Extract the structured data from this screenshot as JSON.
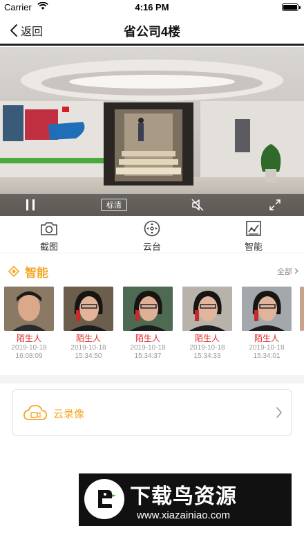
{
  "status_bar": {
    "carrier": "Carrier",
    "time": "4:16 PM"
  },
  "nav": {
    "back_label": "返回",
    "title": "省公司4楼"
  },
  "player": {
    "quality_label": "标清"
  },
  "toolbar": [
    {
      "label": "截图",
      "icon": "camera-icon"
    },
    {
      "label": "云台",
      "icon": "ptz-icon"
    },
    {
      "label": "智能",
      "icon": "smart-chart-icon"
    }
  ],
  "smart": {
    "title": "智能",
    "all_label": "全部",
    "faces": [
      {
        "name": "陌生人",
        "date": "2019-10-18",
        "time": "16:08:09"
      },
      {
        "name": "陌生人",
        "date": "2019-10-18",
        "time": "15:34:50"
      },
      {
        "name": "陌生人",
        "date": "2019-10-18",
        "time": "15:34:37"
      },
      {
        "name": "陌生人",
        "date": "2019-10-18",
        "time": "15:34:33"
      },
      {
        "name": "陌生人",
        "date": "2019-10-18",
        "time": "15:34:01"
      }
    ]
  },
  "cloud": {
    "label": "云录像"
  },
  "watermark": {
    "title": "下载鸟资源",
    "url": "www.xiazainiao.com"
  },
  "colors": {
    "accent": "#f5a623",
    "stranger": "#e02020"
  }
}
